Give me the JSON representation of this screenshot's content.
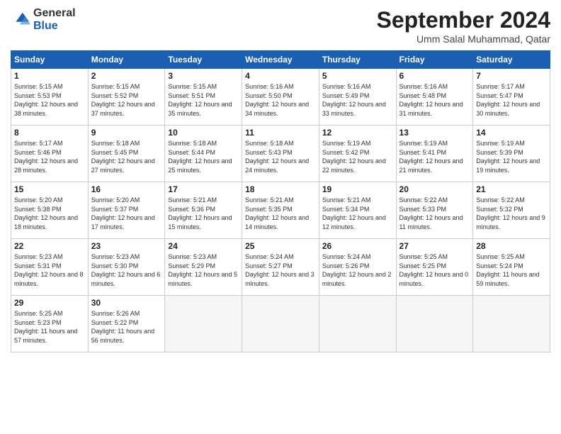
{
  "header": {
    "logo_general": "General",
    "logo_blue": "Blue",
    "title": "September 2024",
    "location": "Umm Salal Muhammad, Qatar"
  },
  "days_of_week": [
    "Sunday",
    "Monday",
    "Tuesday",
    "Wednesday",
    "Thursday",
    "Friday",
    "Saturday"
  ],
  "weeks": [
    [
      {
        "day": "1",
        "sunrise": "Sunrise: 5:15 AM",
        "sunset": "Sunset: 5:53 PM",
        "daylight": "Daylight: 12 hours and 38 minutes."
      },
      {
        "day": "2",
        "sunrise": "Sunrise: 5:15 AM",
        "sunset": "Sunset: 5:52 PM",
        "daylight": "Daylight: 12 hours and 37 minutes."
      },
      {
        "day": "3",
        "sunrise": "Sunrise: 5:15 AM",
        "sunset": "Sunset: 5:51 PM",
        "daylight": "Daylight: 12 hours and 35 minutes."
      },
      {
        "day": "4",
        "sunrise": "Sunrise: 5:16 AM",
        "sunset": "Sunset: 5:50 PM",
        "daylight": "Daylight: 12 hours and 34 minutes."
      },
      {
        "day": "5",
        "sunrise": "Sunrise: 5:16 AM",
        "sunset": "Sunset: 5:49 PM",
        "daylight": "Daylight: 12 hours and 33 minutes."
      },
      {
        "day": "6",
        "sunrise": "Sunrise: 5:16 AM",
        "sunset": "Sunset: 5:48 PM",
        "daylight": "Daylight: 12 hours and 31 minutes."
      },
      {
        "day": "7",
        "sunrise": "Sunrise: 5:17 AM",
        "sunset": "Sunset: 5:47 PM",
        "daylight": "Daylight: 12 hours and 30 minutes."
      }
    ],
    [
      {
        "day": "8",
        "sunrise": "Sunrise: 5:17 AM",
        "sunset": "Sunset: 5:46 PM",
        "daylight": "Daylight: 12 hours and 28 minutes."
      },
      {
        "day": "9",
        "sunrise": "Sunrise: 5:18 AM",
        "sunset": "Sunset: 5:45 PM",
        "daylight": "Daylight: 12 hours and 27 minutes."
      },
      {
        "day": "10",
        "sunrise": "Sunrise: 5:18 AM",
        "sunset": "Sunset: 5:44 PM",
        "daylight": "Daylight: 12 hours and 25 minutes."
      },
      {
        "day": "11",
        "sunrise": "Sunrise: 5:18 AM",
        "sunset": "Sunset: 5:43 PM",
        "daylight": "Daylight: 12 hours and 24 minutes."
      },
      {
        "day": "12",
        "sunrise": "Sunrise: 5:19 AM",
        "sunset": "Sunset: 5:42 PM",
        "daylight": "Daylight: 12 hours and 22 minutes."
      },
      {
        "day": "13",
        "sunrise": "Sunrise: 5:19 AM",
        "sunset": "Sunset: 5:41 PM",
        "daylight": "Daylight: 12 hours and 21 minutes."
      },
      {
        "day": "14",
        "sunrise": "Sunrise: 5:19 AM",
        "sunset": "Sunset: 5:39 PM",
        "daylight": "Daylight: 12 hours and 19 minutes."
      }
    ],
    [
      {
        "day": "15",
        "sunrise": "Sunrise: 5:20 AM",
        "sunset": "Sunset: 5:38 PM",
        "daylight": "Daylight: 12 hours and 18 minutes."
      },
      {
        "day": "16",
        "sunrise": "Sunrise: 5:20 AM",
        "sunset": "Sunset: 5:37 PM",
        "daylight": "Daylight: 12 hours and 17 minutes."
      },
      {
        "day": "17",
        "sunrise": "Sunrise: 5:21 AM",
        "sunset": "Sunset: 5:36 PM",
        "daylight": "Daylight: 12 hours and 15 minutes."
      },
      {
        "day": "18",
        "sunrise": "Sunrise: 5:21 AM",
        "sunset": "Sunset: 5:35 PM",
        "daylight": "Daylight: 12 hours and 14 minutes."
      },
      {
        "day": "19",
        "sunrise": "Sunrise: 5:21 AM",
        "sunset": "Sunset: 5:34 PM",
        "daylight": "Daylight: 12 hours and 12 minutes."
      },
      {
        "day": "20",
        "sunrise": "Sunrise: 5:22 AM",
        "sunset": "Sunset: 5:33 PM",
        "daylight": "Daylight: 12 hours and 11 minutes."
      },
      {
        "day": "21",
        "sunrise": "Sunrise: 5:22 AM",
        "sunset": "Sunset: 5:32 PM",
        "daylight": "Daylight: 12 hours and 9 minutes."
      }
    ],
    [
      {
        "day": "22",
        "sunrise": "Sunrise: 5:23 AM",
        "sunset": "Sunset: 5:31 PM",
        "daylight": "Daylight: 12 hours and 8 minutes."
      },
      {
        "day": "23",
        "sunrise": "Sunrise: 5:23 AM",
        "sunset": "Sunset: 5:30 PM",
        "daylight": "Daylight: 12 hours and 6 minutes."
      },
      {
        "day": "24",
        "sunrise": "Sunrise: 5:23 AM",
        "sunset": "Sunset: 5:29 PM",
        "daylight": "Daylight: 12 hours and 5 minutes."
      },
      {
        "day": "25",
        "sunrise": "Sunrise: 5:24 AM",
        "sunset": "Sunset: 5:27 PM",
        "daylight": "Daylight: 12 hours and 3 minutes."
      },
      {
        "day": "26",
        "sunrise": "Sunrise: 5:24 AM",
        "sunset": "Sunset: 5:26 PM",
        "daylight": "Daylight: 12 hours and 2 minutes."
      },
      {
        "day": "27",
        "sunrise": "Sunrise: 5:25 AM",
        "sunset": "Sunset: 5:25 PM",
        "daylight": "Daylight: 12 hours and 0 minutes."
      },
      {
        "day": "28",
        "sunrise": "Sunrise: 5:25 AM",
        "sunset": "Sunset: 5:24 PM",
        "daylight": "Daylight: 11 hours and 59 minutes."
      }
    ],
    [
      {
        "day": "29",
        "sunrise": "Sunrise: 5:25 AM",
        "sunset": "Sunset: 5:23 PM",
        "daylight": "Daylight: 11 hours and 57 minutes."
      },
      {
        "day": "30",
        "sunrise": "Sunrise: 5:26 AM",
        "sunset": "Sunset: 5:22 PM",
        "daylight": "Daylight: 11 hours and 56 minutes."
      },
      null,
      null,
      null,
      null,
      null
    ]
  ]
}
